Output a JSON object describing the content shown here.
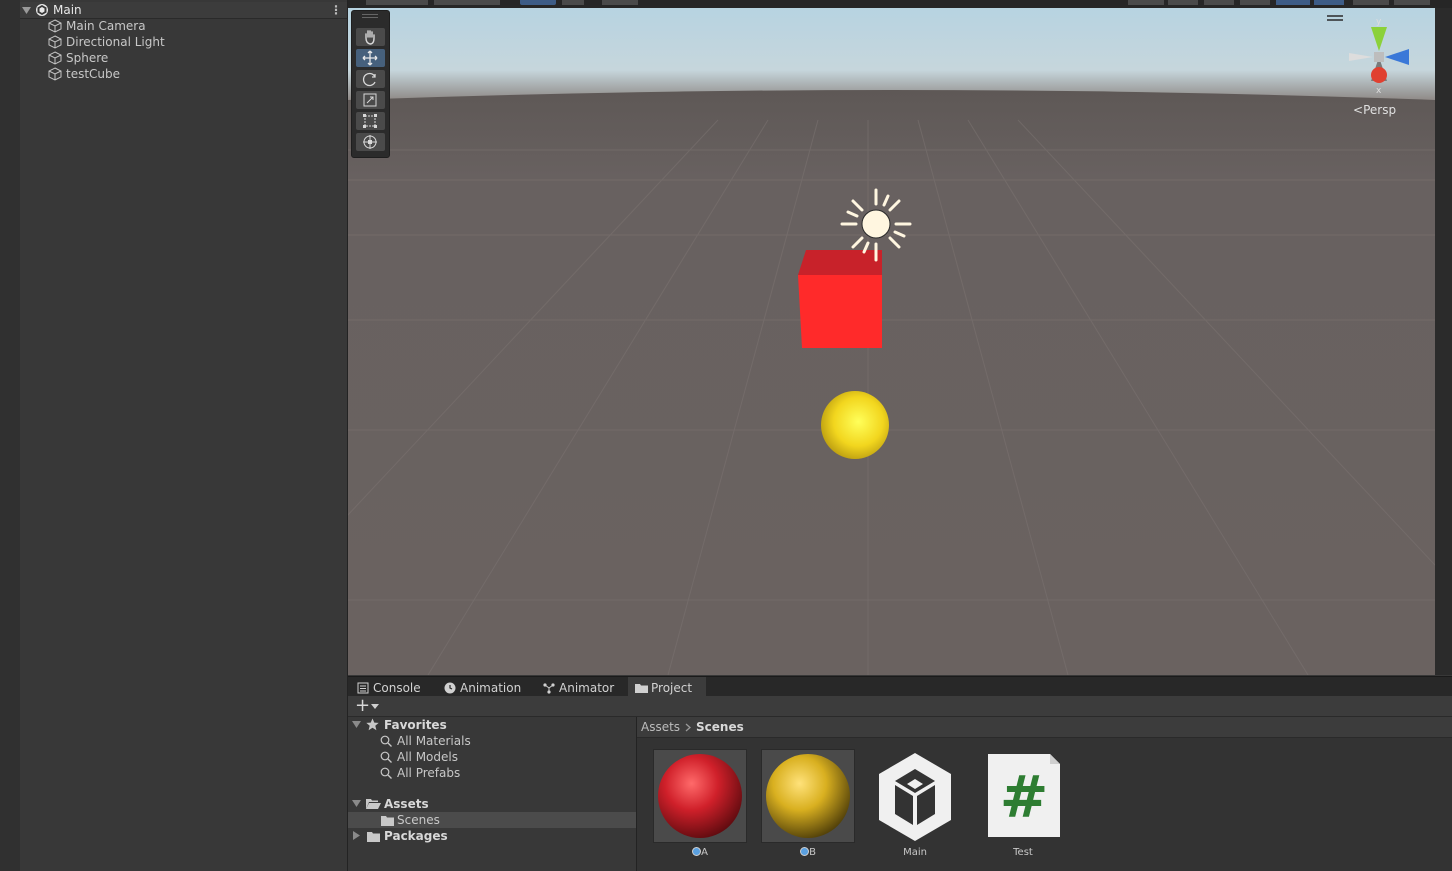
{
  "hierarchy": {
    "scene_name": "Main",
    "objects": [
      "Main Camera",
      "Directional Light",
      "Sphere",
      "testCube"
    ]
  },
  "scene_view": {
    "projection_label": "Persp",
    "gizmo_axes": {
      "y": "y",
      "x": "x"
    },
    "tools": [
      "hand-tool",
      "move-tool",
      "rotate-tool",
      "scale-tool",
      "rect-tool",
      "transform-tool"
    ],
    "selected_tool": "move-tool",
    "colors": {
      "cube": "#ff2a2a",
      "sphere": "#f5e12a",
      "ground": "#6a6260",
      "sky": "#b5d3e2"
    }
  },
  "bottom_panel": {
    "tabs": [
      "Console",
      "Animation",
      "Animator",
      "Project"
    ],
    "active_tab": "Project",
    "favorites": {
      "label": "Favorites",
      "items": [
        "All Materials",
        "All Models",
        "All Prefabs"
      ]
    },
    "assets_folder": {
      "label": "Assets",
      "children": [
        "Scenes"
      ]
    },
    "packages_folder": "Packages",
    "breadcrumb": {
      "root": "Assets",
      "current": "Scenes"
    },
    "assets": [
      {
        "name": "A",
        "type": "material",
        "color": "#d0202a"
      },
      {
        "name": "B",
        "type": "material",
        "color": "#d9b020"
      },
      {
        "name": "Main",
        "type": "scene"
      },
      {
        "name": "Test",
        "type": "script",
        "glyph": "#"
      }
    ]
  }
}
